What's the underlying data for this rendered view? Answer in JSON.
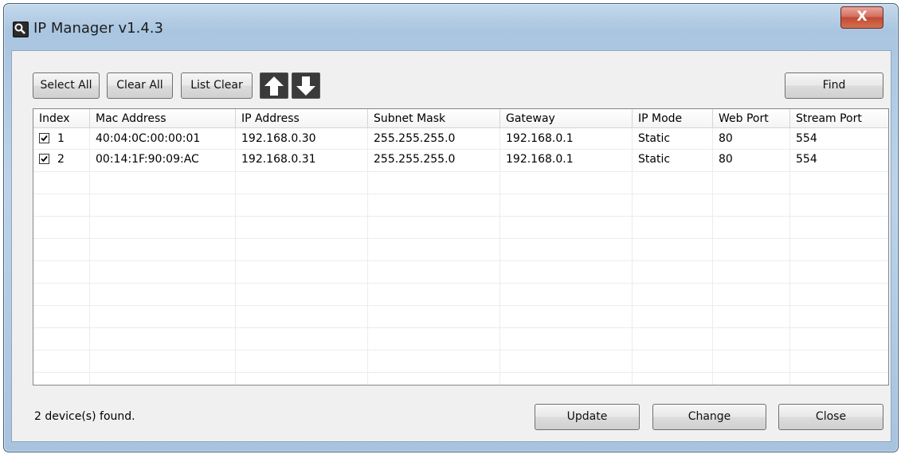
{
  "window": {
    "title": "IP Manager v1.4.3",
    "close_glyph": "X"
  },
  "toolbar": {
    "select_all_label": "Select All",
    "clear_all_label": "Clear All",
    "list_clear_label": "List Clear",
    "move_up_icon": "arrow-up-icon",
    "move_down_icon": "arrow-down-icon",
    "find_label": "Find"
  },
  "table": {
    "columns": [
      "Index",
      "Mac Address",
      "IP Address",
      "Subnet Mask",
      "Gateway",
      "IP Mode",
      "Web Port",
      "Stream Port"
    ],
    "rows": [
      {
        "checked": true,
        "index": "1",
        "mac": "40:04:0C:00:00:01",
        "ip": "192.168.0.30",
        "subnet": "255.255.255.0",
        "gateway": "192.168.0.1",
        "mode": "Static",
        "web_port": "80",
        "stream_port": "554"
      },
      {
        "checked": true,
        "index": "2",
        "mac": "00:14:1F:90:09:AC",
        "ip": "192.168.0.31",
        "subnet": "255.255.255.0",
        "gateway": "192.168.0.1",
        "mode": "Static",
        "web_port": "80",
        "stream_port": "554"
      }
    ]
  },
  "footer": {
    "status_text": "2 device(s) found.",
    "update_label": "Update",
    "change_label": "Change",
    "close_label": "Close"
  },
  "colors": {
    "titlebar": "#bcd3ea",
    "client_bg": "#f0f0f0",
    "close_button": "#c24a36"
  }
}
